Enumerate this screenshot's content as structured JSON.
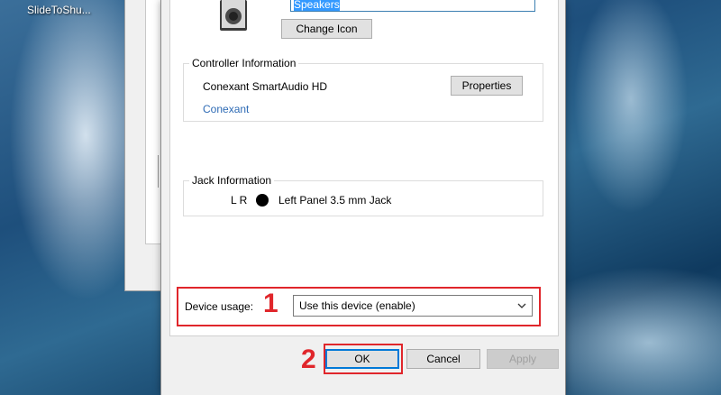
{
  "desktop": {
    "icon_label": "SlideToShu..."
  },
  "dialog": {
    "name_field_value": "Speakers",
    "change_icon_label": "Change Icon",
    "controller_info": {
      "title": "Controller Information",
      "device_name": "Conexant SmartAudio HD",
      "properties_label": "Properties",
      "vendor_link": "Conexant"
    },
    "jack_info": {
      "title": "Jack Information",
      "channels": "L R",
      "jack_label": "Left Panel 3.5 mm Jack"
    },
    "device_usage": {
      "label": "Device usage:",
      "selected": "Use this device (enable)"
    },
    "buttons": {
      "ok": "OK",
      "cancel": "Cancel",
      "apply": "Apply"
    }
  },
  "annotations": {
    "step1": "1",
    "step2": "2"
  },
  "colors": {
    "highlight": "#e0262b",
    "link": "#2e6bb5",
    "selection": "#3399ff",
    "focus_border": "#0078d7"
  }
}
